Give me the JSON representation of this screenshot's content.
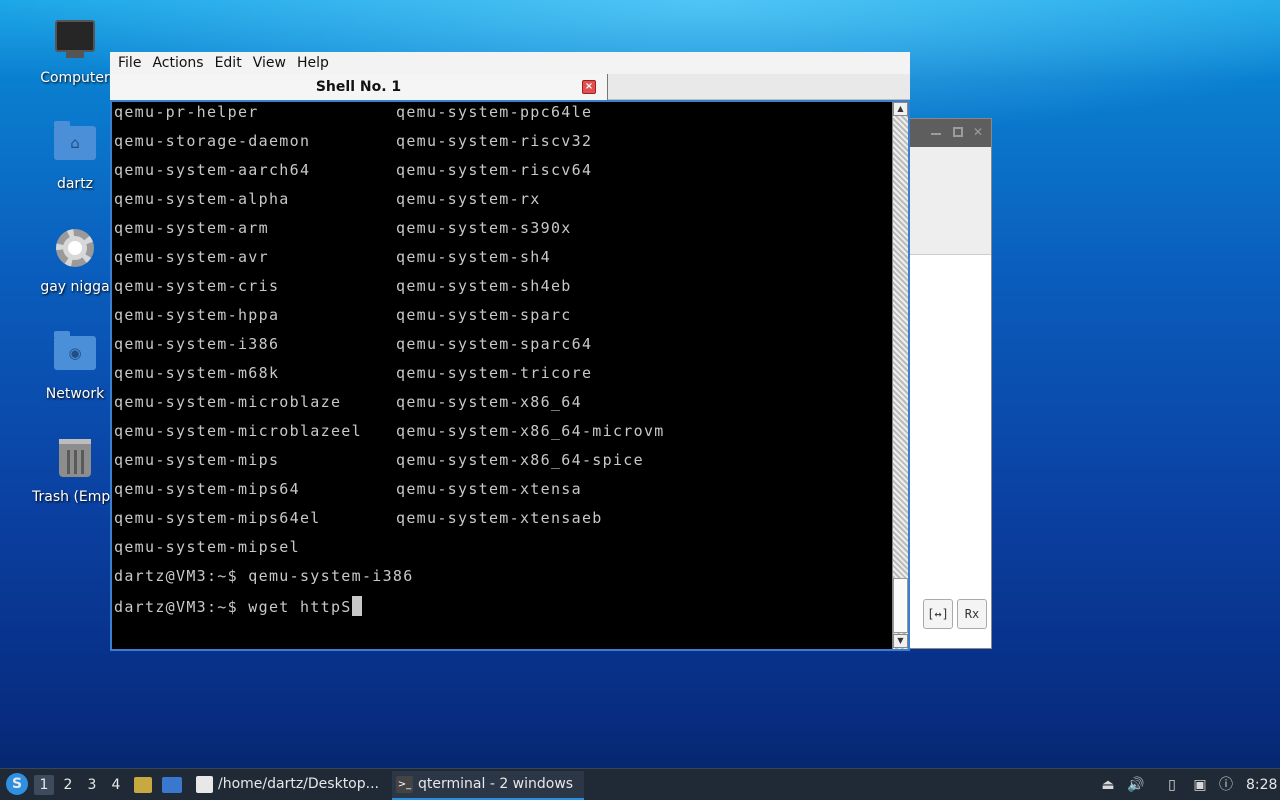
{
  "desktop": {
    "icons": [
      {
        "label": "Computer",
        "icon": "computer-icon"
      },
      {
        "label": "dartz",
        "icon": "home-folder-icon"
      },
      {
        "label": "gay nigga",
        "icon": "gear-icon"
      },
      {
        "label": "Network",
        "icon": "network-folder-icon"
      },
      {
        "label": "Trash (Empty)",
        "icon": "trash-icon"
      }
    ]
  },
  "terminal": {
    "menu": [
      "File",
      "Actions",
      "Edit",
      "View",
      "Help"
    ],
    "tab_title": "Shell No. 1",
    "tab_close": "×",
    "rows": [
      {
        "c1": "qemu-pr-helper",
        "c2": "qemu-system-ppc64le"
      },
      {
        "c1": "qemu-storage-daemon",
        "c2": "qemu-system-riscv32"
      },
      {
        "c1": "qemu-system-aarch64",
        "c2": "qemu-system-riscv64"
      },
      {
        "c1": "qemu-system-alpha",
        "c2": "qemu-system-rx"
      },
      {
        "c1": "qemu-system-arm",
        "c2": "qemu-system-s390x"
      },
      {
        "c1": "qemu-system-avr",
        "c2": "qemu-system-sh4"
      },
      {
        "c1": "qemu-system-cris",
        "c2": "qemu-system-sh4eb"
      },
      {
        "c1": "qemu-system-hppa",
        "c2": "qemu-system-sparc"
      },
      {
        "c1": "qemu-system-i386",
        "c2": "qemu-system-sparc64"
      },
      {
        "c1": "qemu-system-m68k",
        "c2": "qemu-system-tricore"
      },
      {
        "c1": "qemu-system-microblaze",
        "c2": "qemu-system-x86_64"
      },
      {
        "c1": "qemu-system-microblazeel",
        "c2": "qemu-system-x86_64-microvm"
      },
      {
        "c1": "qemu-system-mips",
        "c2": "qemu-system-x86_64-spice"
      },
      {
        "c1": "qemu-system-mips64",
        "c2": "qemu-system-xtensa"
      },
      {
        "c1": "qemu-system-mips64el",
        "c2": "qemu-system-xtensaeb"
      },
      {
        "c1": "qemu-system-mipsel",
        "c2": ""
      }
    ],
    "prompt_lines": [
      "dartz@VM3:~$ qemu-system-i386",
      "dartz@VM3:~$ wget httpS"
    ]
  },
  "background_window": {
    "buttons": [
      "[↔]",
      "Rx"
    ]
  },
  "taskbar": {
    "start_icon": "start-menu-icon",
    "workspaces": [
      "1",
      "2",
      "3",
      "4"
    ],
    "active_workspace": "1",
    "tasks": [
      {
        "label": "/home/dartz/Desktop...",
        "icon": "text-editor-icon",
        "active": false
      },
      {
        "label": "qterminal - 2 windows",
        "icon": "terminal-icon",
        "active": true
      }
    ],
    "clock": "8:28",
    "colors": {
      "accent": "#2b8fe0",
      "panel": "#202a36"
    }
  }
}
